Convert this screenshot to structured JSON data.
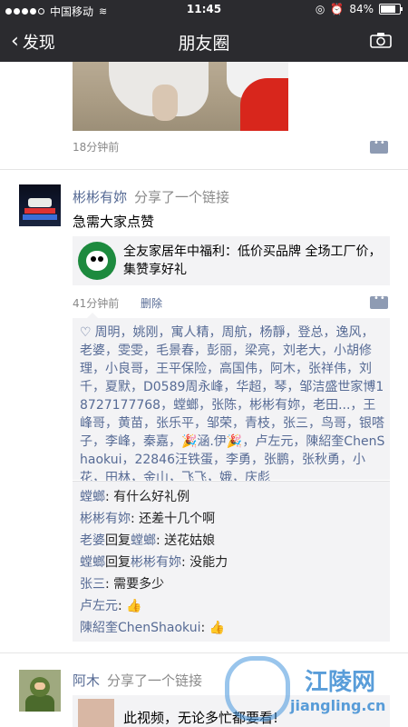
{
  "status": {
    "carrier": "中国移动",
    "time": "11:45",
    "battery": "84%",
    "battery_level": 0.84
  },
  "nav": {
    "back_label": "发现",
    "title": "朋友圈"
  },
  "post1": {
    "time": "18分钟前"
  },
  "post2": {
    "author": "彬彬有妳",
    "action": "分享了一个链接",
    "text": "急需大家点赞",
    "link_title": "全友家居年中福利：低价买品牌 全场工厂价，集赞享好礼",
    "time": "41分钟前",
    "delete_label": "删除",
    "likes": "周明，姚刚，寓人精，周航，杨靜，登总，逸风，老婆，雯雯，毛景春，彭丽，梁亮，刘老大，小胡修理，小良哥，王平保险，高国伟，阿木，张祥伟，刘千，夏默，D0589周永峰，华超，琴，邹洁盛世家博18727177768，螳螂，张陈，彬彬有妳，老田...，王峰哥，黄苗，张乐平，邹荣，青枝，张三，鸟哥，银嗒子，李峰，秦嘉，🎉涵.伊🎉，卢左元，陳紹奎ChenShaokui，22846汪铁蛋，李勇，张鹏，张秋勇，小花，田林，金山，飞飞，娥，庆彪",
    "comments": [
      {
        "name": "螳螂",
        "reply_to": "",
        "text": "有什么好礼例"
      },
      {
        "name": "彬彬有妳",
        "reply_to": "",
        "text": "还差十几个啊"
      },
      {
        "name": "老婆",
        "reply_to": "螳螂",
        "text": "送花姑娘"
      },
      {
        "name": "螳螂",
        "reply_to": "彬彬有妳",
        "text": "没能力"
      },
      {
        "name": "张三",
        "reply_to": "",
        "text": "需要多少"
      },
      {
        "name": "卢左元",
        "reply_to": "",
        "text": "👍"
      },
      {
        "name": "陳紹奎ChenShaokui",
        "reply_to": "",
        "text": "👍"
      }
    ],
    "reply_word": "回复",
    "colon": ": "
  },
  "post3": {
    "author": "阿木",
    "action": "分享了一个链接",
    "link_title": "此视频，无论多忙都要看!"
  },
  "watermark": {
    "name": "江陵网",
    "url": "jiangling.cn"
  },
  "colors": {
    "link_blue": "#576b95",
    "bar_dark": "#2b2b2f",
    "card_bg": "#f3f3f5"
  }
}
